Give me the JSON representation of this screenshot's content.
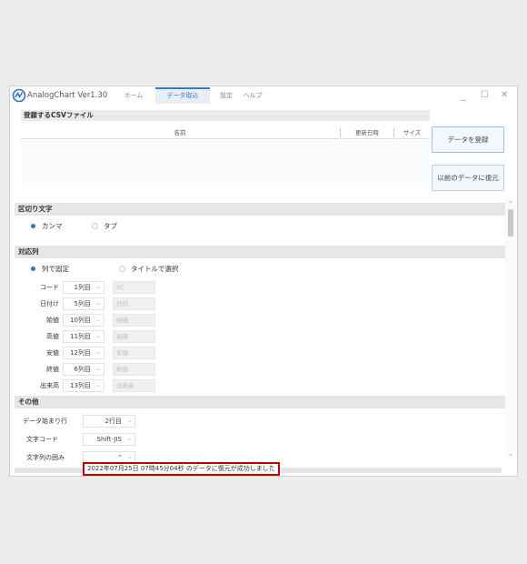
{
  "app": {
    "title": "AnalogChart Ver1.30",
    "tabs": [
      {
        "label": "ホーム",
        "active": false
      },
      {
        "label": "データ取込",
        "active": true
      },
      {
        "label": "設定",
        "active": false
      },
      {
        "label": "ヘルプ",
        "active": false
      }
    ],
    "window_controls": {
      "minimize": "_",
      "maximize": "☐",
      "close": "✕"
    },
    "accent_color": "#2d72c8",
    "icon": "analogchart-logo-icon"
  },
  "csv": {
    "section_title": "登録するCSVファイル",
    "columns": [
      "名前",
      "更新日時",
      "サイズ"
    ],
    "rows": []
  },
  "buttons": {
    "register": "データを登録",
    "restore": "以前のデータに復元"
  },
  "delimiter": {
    "title": "区切り文字",
    "options": [
      {
        "label": "カンマ",
        "selected": true
      },
      {
        "label": "タブ",
        "selected": false
      }
    ]
  },
  "mapping": {
    "title": "対応列",
    "modes": [
      {
        "label": "列で固定",
        "selected": true
      },
      {
        "label": "タイトルで選択",
        "selected": false
      }
    ],
    "rows": [
      {
        "label": "コード",
        "column": "1列目",
        "title": "SC"
      },
      {
        "label": "日付け",
        "column": "5列目",
        "title": "日付"
      },
      {
        "label": "始値",
        "column": "10列目",
        "title": "始値"
      },
      {
        "label": "高値",
        "column": "11列目",
        "title": "高値"
      },
      {
        "label": "安値",
        "column": "12列目",
        "title": "安値"
      },
      {
        "label": "終値",
        "column": "6列目",
        "title": "終値"
      },
      {
        "label": "出来高",
        "column": "13列目",
        "title": "出来高"
      }
    ]
  },
  "other": {
    "title": "その他",
    "rows": [
      {
        "label": "データ始まり行",
        "value": "2行目"
      },
      {
        "label": "文字コード",
        "value": "Shift-JIS"
      },
      {
        "label": "文字列の囲み",
        "value": "\""
      }
    ]
  },
  "status": {
    "message": "2022年07月25日 07時45分04秒 のデータに復元が成功しました",
    "highlight_color": "#c00000"
  }
}
